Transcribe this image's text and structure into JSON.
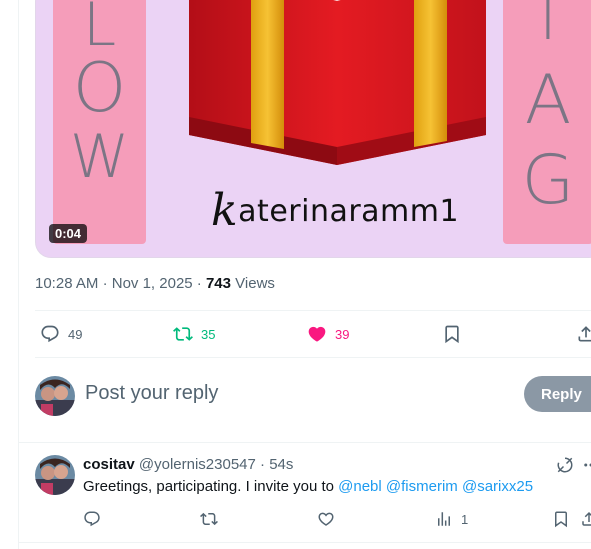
{
  "media": {
    "duration": "0:04",
    "left_letters": [
      "L",
      "O",
      "W"
    ],
    "right_letters": [
      "I",
      "A",
      "G"
    ],
    "watermark_k": "k",
    "watermark_rest": "aterinaramm1"
  },
  "tweet": {
    "time": "10:28 AM",
    "date": "Nov 1, 2025",
    "separator": "·",
    "views_count": "743",
    "views_label": "Views"
  },
  "actions": {
    "replies": "49",
    "retweets": "35",
    "likes": "39"
  },
  "composer": {
    "placeholder": "Post your reply",
    "reply_label": "Reply"
  },
  "reply": {
    "name": "cositav",
    "handle": "@yolernis230547",
    "age": "54s",
    "text": "Greetings, participating. I invite you to",
    "mentions": [
      "@nebl",
      "@fismerim",
      "@sarixx25"
    ],
    "views": "1"
  },
  "colors": {
    "accent": "#1d9bf0",
    "retweet": "#00ba7c",
    "like": "#f91880",
    "muted": "#536471",
    "media_bg": "#ebd3f5",
    "panel_pink": "#f59dba"
  }
}
